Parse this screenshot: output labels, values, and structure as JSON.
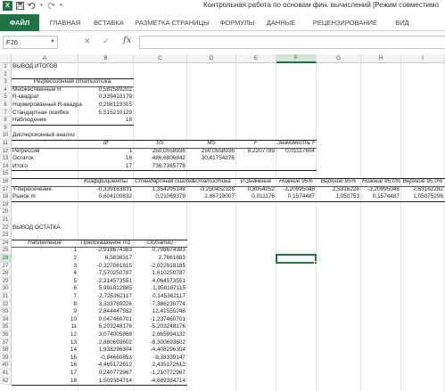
{
  "window": {
    "title": "Контрольная работа по основам фин. вычислений  [Режим совместимо",
    "logo": "X"
  },
  "qat": {
    "save_icon": "save-icon",
    "undo_icon": "undo-icon",
    "redo_icon": "redo-icon"
  },
  "ribbon": {
    "tabs": [
      "ФАЙЛ",
      "ГЛАВНАЯ",
      "ВСТАВКА",
      "РАЗМЕТКА СТРАНИЦЫ",
      "ФОРМУЛЫ",
      "ДАННЫЕ",
      "РЕЦЕНЗИРОВАНИЕ",
      "ВИД"
    ]
  },
  "formula_bar": {
    "name_box": "F26",
    "fx": "fx",
    "value": ""
  },
  "columns": [
    "A",
    "B",
    "C",
    "D",
    "E",
    "F",
    "G",
    "H",
    "I"
  ],
  "selected_column": "F",
  "selected_row": "26",
  "rows": [
    {
      "n": "1",
      "cells": {
        "A": "ВЫВОД ИТОГОВ"
      }
    },
    {
      "n": "2",
      "cells": {}
    },
    {
      "n": "3",
      "cells": {
        "A": "Регрессионная статистика"
      }
    },
    {
      "n": "4",
      "cells": {
        "A": "Множественный R",
        "B": "0,582589202"
      }
    },
    {
      "n": "5",
      "cells": {
        "A": "R-квадрат",
        "B": "0,339410179"
      }
    },
    {
      "n": "6",
      "cells": {
        "A": "Нормированный R-квадра",
        "B": "0,298123315"
      }
    },
    {
      "n": "7",
      "cells": {
        "A": "Стандартная ошибка",
        "B": "5,515210129"
      }
    },
    {
      "n": "8",
      "cells": {
        "A": "Наблюдения",
        "B": "18"
      }
    },
    {
      "n": "9",
      "cells": {}
    },
    {
      "n": "10",
      "cells": {
        "A": "Дисперсионный анализ"
      }
    },
    {
      "n": "11",
      "cells": {
        "B": "df",
        "C": "SS",
        "D": "MS",
        "E": "F",
        "F": "Значимость F"
      }
    },
    {
      "n": "12",
      "cells": {
        "A": "Регрессия",
        "B": "1",
        "C": "250,0558936",
        "D": "250,0558936",
        "E": "8,2207789",
        "F": "0,01117604"
      }
    },
    {
      "n": "13",
      "cells": {
        "A": "Остаток",
        "B": "16",
        "C": "486,6806842",
        "D": "30,41754276"
      }
    },
    {
      "n": "14",
      "cells": {
        "A": "Итого",
        "B": "17",
        "C": "736,7365778"
      }
    },
    {
      "n": "15",
      "cells": {}
    },
    {
      "n": "16",
      "cells": {
        "B": "Коэффициенты",
        "C": "Стандартная ошибка",
        "D": "t-статистика",
        "E": "P-Значение",
        "F": "Нижние 95%",
        "G": "Верхние 95%",
        "H": "Нижние 95,0%",
        "I": "Верхние 95,0%"
      }
    },
    {
      "n": "17",
      "cells": {
        "A": "Y-пересечение",
        "B": "-0,339163831",
        "C": "1,354205148",
        "D": "-0,250452328",
        "E": "0,8054252",
        "F": "-3,20995048",
        "G": "2,5316228",
        "H": "-3,20995048",
        "I": "2,53162282"
      }
    },
    {
      "n": "18",
      "cells": {
        "A": "Рынок m",
        "B": "0,604100832",
        "C": "0,21069379",
        "D": "2,86719007",
        "E": "0,011176",
        "F": "0,1574487",
        "G": "1,050753",
        "H": "0,1574487",
        "I": "1,05075296"
      }
    },
    {
      "n": "19",
      "cells": {}
    },
    {
      "n": "20",
      "cells": {}
    },
    {
      "n": "21",
      "cells": {}
    },
    {
      "n": "22",
      "cells": {
        "A": "ВЫВОД ОСТАТКА"
      }
    },
    {
      "n": "23",
      "cells": {}
    },
    {
      "n": "24",
      "cells": {
        "A": "Наблюдение",
        "B": "Предсказанное m1",
        "C": "Остатки"
      }
    },
    {
      "n": "25",
      "cells": {
        "A": "1",
        "B": "-2,918674383",
        "C": "0,798674383"
      }
    },
    {
      "n": "26",
      "cells": {
        "A": "2",
        "B": "6,5838317",
        "C": "2,7661683"
      }
    },
    {
      "n": "27",
      "cells": {
        "A": "3",
        "B": "-0,327081815",
        "C": "-2,022918185"
      }
    },
    {
      "n": "28",
      "cells": {
        "A": "4",
        "B": "-7,570250787",
        "C": "1,610250787"
      }
    },
    {
      "n": "29",
      "cells": {
        "A": "5",
        "B": "-2,314573551",
        "C": "4,064573551"
      }
    },
    {
      "n": "30",
      "cells": {
        "A": "6",
        "B": "5,991812885",
        "C": "1,958187115"
      }
    },
    {
      "n": "31",
      "cells": {
        "A": "7",
        "B": "-2,725362117",
        "C": "0,145362117"
      }
    },
    {
      "n": "32",
      "cells": {
        "A": "8",
        "B": "3,333769226",
        "C": "7,386230774"
      }
    },
    {
      "n": "33",
      "cells": {
        "A": "9",
        "B": "2,844447552",
        "C": "12,41555248"
      }
    },
    {
      "n": "34",
      "cells": {
        "A": "10",
        "B": "0,047460701",
        "C": "-1,237460701"
      }
    },
    {
      "n": "35",
      "cells": {
        "A": "11",
        "B": "6,203248176",
        "C": "-5,203248176"
      }
    },
    {
      "n": "36",
      "cells": {
        "A": "12",
        "B": "3,074005868",
        "C": "2,865994132"
      }
    },
    {
      "n": "37",
      "cells": {
        "A": "13",
        "B": "2,880693602",
        "C": "-8,300693602"
      }
    },
    {
      "n": "38",
      "cells": {
        "A": "14",
        "B": "1,938296304",
        "C": "-4,408296304"
      }
    },
    {
      "n": "39",
      "cells": {
        "A": "15",
        "B": "-0,84660853",
        "C": "-9,38339147"
      }
    },
    {
      "n": "40",
      "cells": {
        "A": "16",
        "B": "-4,465172612",
        "C": "2,435172612"
      }
    },
    {
      "n": "41",
      "cells": {
        "A": "17",
        "B": "0,240772967",
        "C": "-1,210772967"
      }
    },
    {
      "n": "42",
      "cells": {
        "A": "18",
        "B": "1,509384714",
        "C": "-4,689384714"
      }
    }
  ]
}
